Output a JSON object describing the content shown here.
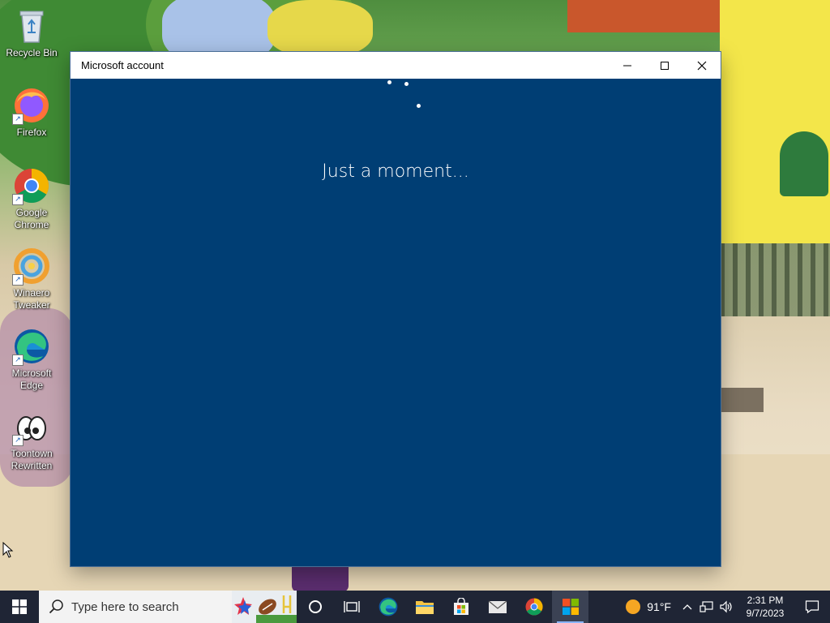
{
  "desktop": {
    "icons": [
      {
        "label": "Recycle Bin",
        "icon": "recycle-bin-icon"
      },
      {
        "label": "Firefox",
        "icon": "firefox-icon"
      },
      {
        "label": "Google Chrome",
        "icon": "chrome-icon"
      },
      {
        "label": "Winaero Tweaker",
        "icon": "winaero-tweaker-icon"
      },
      {
        "label": "Microsoft Edge",
        "icon": "edge-icon"
      },
      {
        "label": "Toontown Rewritten",
        "icon": "toontown-icon"
      }
    ]
  },
  "window": {
    "title": "Microsoft account",
    "message": "Just a moment...",
    "background_color": "#003e74"
  },
  "taskbar": {
    "search_placeholder": "Type here to search",
    "apps": [
      {
        "name": "cortana",
        "icon": "cortana-circle-icon"
      },
      {
        "name": "task-view",
        "icon": "task-view-icon"
      },
      {
        "name": "edge",
        "icon": "edge-icon"
      },
      {
        "name": "file-explorer",
        "icon": "folder-icon"
      },
      {
        "name": "microsoft-store",
        "icon": "store-icon"
      },
      {
        "name": "mail",
        "icon": "mail-icon"
      },
      {
        "name": "chrome",
        "icon": "chrome-icon"
      },
      {
        "name": "microsoft-account",
        "icon": "windows-logo-icon",
        "active": true
      }
    ],
    "weather": {
      "temp": "91°F"
    },
    "clock": {
      "time": "2:31 PM",
      "date": "9/7/2023"
    }
  }
}
